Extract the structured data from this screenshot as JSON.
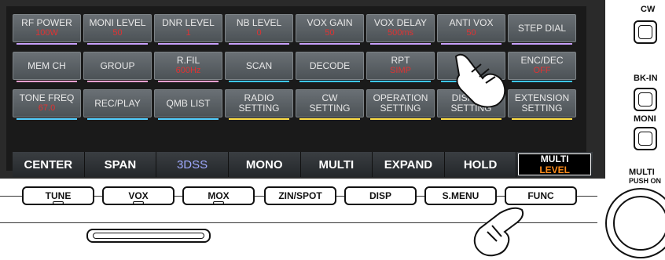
{
  "menu": {
    "row1": [
      {
        "label": "RF POWER",
        "value": "100W",
        "line": "#c8a0ff"
      },
      {
        "label": "MONI LEVEL",
        "value": "50",
        "line": "#c8a0ff"
      },
      {
        "label": "DNR LEVEL",
        "value": "1",
        "line": "#c8a0ff"
      },
      {
        "label": "NB LEVEL",
        "value": "0",
        "line": "#c8a0ff"
      },
      {
        "label": "VOX GAIN",
        "value": "50",
        "line": "#c8a0ff"
      },
      {
        "label": "VOX DELAY",
        "value": "500ms",
        "line": "#c8a0ff"
      },
      {
        "label": "ANTI VOX",
        "value": "50",
        "line": "#c8a0ff"
      },
      {
        "label": "STEP DIAL",
        "value": "",
        "line": "#c8a0ff"
      }
    ],
    "row2": [
      {
        "label": "MEM CH",
        "value": "",
        "line": "#ffa0d0"
      },
      {
        "label": "GROUP",
        "value": "",
        "line": "#ffa0d0"
      },
      {
        "label": "R.FIL",
        "value": "600Hz",
        "line": "#ffa0d0"
      },
      {
        "label": "SCAN",
        "value": "",
        "line": "#3dc7ff"
      },
      {
        "label": "DECODE",
        "value": "",
        "line": "#3dc7ff"
      },
      {
        "label": "RPT",
        "value": "SIMP",
        "line": "#3dc7ff"
      },
      {
        "label": "",
        "value": "",
        "line": "#3dc7ff"
      },
      {
        "label": "ENC/DEC",
        "value": "OFF",
        "line": "#3dc7ff"
      }
    ],
    "row3": [
      {
        "label": "TONE FREQ",
        "value": "67.0",
        "line": "#56d0ff"
      },
      {
        "label": "REC/PLAY",
        "value": "",
        "line": "#56d0ff"
      },
      {
        "label": "QMB LIST",
        "value": "",
        "line": "#56d0ff"
      },
      {
        "label": "RADIO",
        "label2": "SETTING",
        "line": "#ffe04a"
      },
      {
        "label": "CW",
        "label2": "SETTING",
        "line": "#ffe04a"
      },
      {
        "label": "OPERATION",
        "label2": "SETTING",
        "line": "#ffe04a"
      },
      {
        "label": "DISPLAY",
        "label2": "SETTING",
        "line": "#ffe04a"
      },
      {
        "label": "EXTENSION",
        "label2": "SETTING",
        "line": "#ffe04a"
      }
    ]
  },
  "bottom_bar": [
    "CENTER",
    "SPAN",
    "3DSS",
    "MONO",
    "MULTI",
    "EXPAND",
    "HOLD"
  ],
  "multi_level": {
    "top": "MULTI",
    "bottom": "LEVEL"
  },
  "hardware_buttons": [
    "TUNE",
    "VOX",
    "MOX",
    "ZIN/SPOT",
    "DISP",
    "S.MENU",
    "FUNC"
  ],
  "side": {
    "cw": "CW",
    "bkin": "BK-IN",
    "moni": "MONI",
    "multi": "MULTI",
    "push_on": "PUSH ON"
  }
}
